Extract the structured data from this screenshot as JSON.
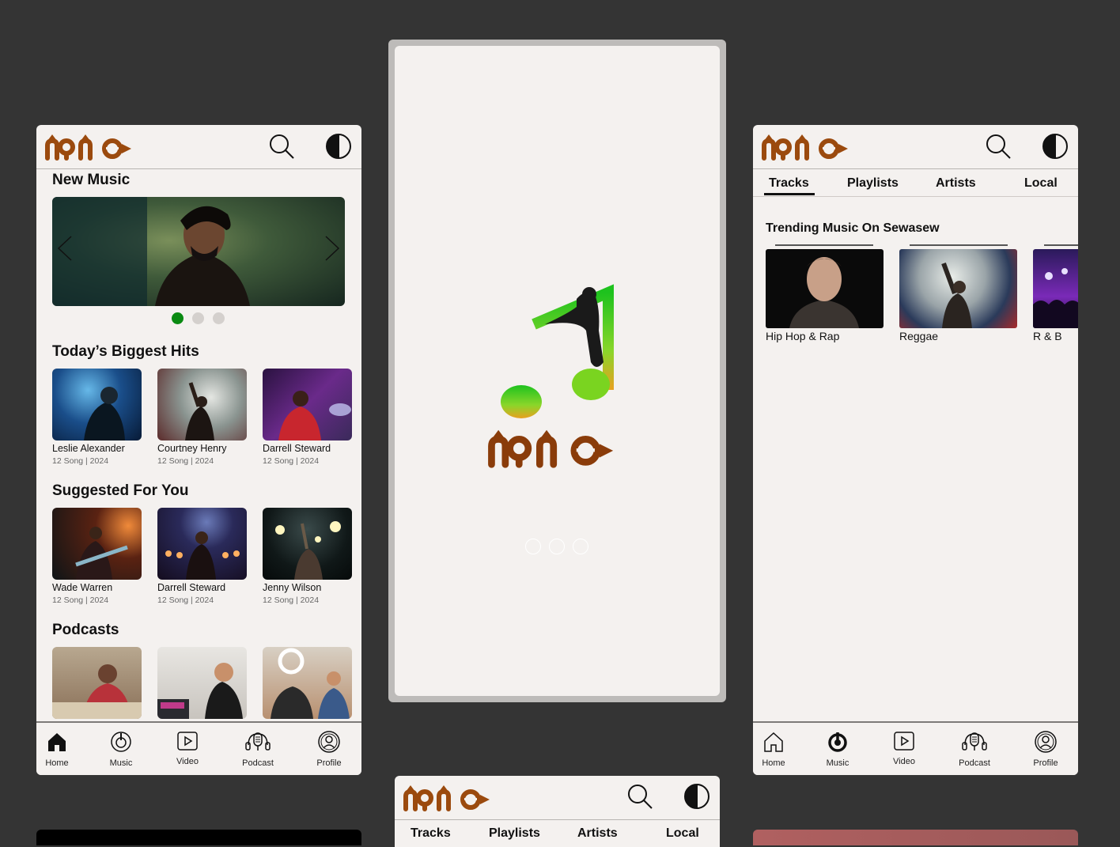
{
  "brand": {
    "logo_text": "ሰዋሰው",
    "accent": "#9b4a0e",
    "green": "#0a8a12"
  },
  "home": {
    "new_music_title": "New Music",
    "hits_title": "Today’s Biggest Hits",
    "hits": [
      {
        "name": "Leslie Alexander",
        "meta": "12 Song | 2024"
      },
      {
        "name": "Courtney Henry",
        "meta": "12 Song | 2024"
      },
      {
        "name": "Darrell Steward",
        "meta": "12 Song | 2024"
      }
    ],
    "suggested_title": "Suggested For You",
    "suggested": [
      {
        "name": "Wade Warren",
        "meta": "12 Song | 2024"
      },
      {
        "name": "Darrell Steward",
        "meta": "12 Song | 2024"
      },
      {
        "name": "Jenny Wilson",
        "meta": "12 Song | 2024"
      }
    ],
    "podcasts_title": "Podcasts"
  },
  "nav": {
    "home": "Home",
    "music": "Music",
    "video": "Video",
    "podcast": "Podcast",
    "profile": "Profile"
  },
  "tabs": {
    "tracks": "Tracks",
    "playlists": "Playlists",
    "artists": "Artists",
    "local": "Local"
  },
  "music": {
    "trending_title": "Trending Music On Sewasew",
    "genres": [
      {
        "name": "Hip Hop & Rap"
      },
      {
        "name": "Reggae"
      },
      {
        "name": "R & B"
      }
    ]
  },
  "icons": [
    "search-icon",
    "theme-toggle-icon",
    "chevron-left-icon",
    "chevron-right-icon",
    "home-icon",
    "music-icon",
    "video-icon",
    "podcast-icon",
    "profile-icon",
    "music-note-logo-icon"
  ]
}
